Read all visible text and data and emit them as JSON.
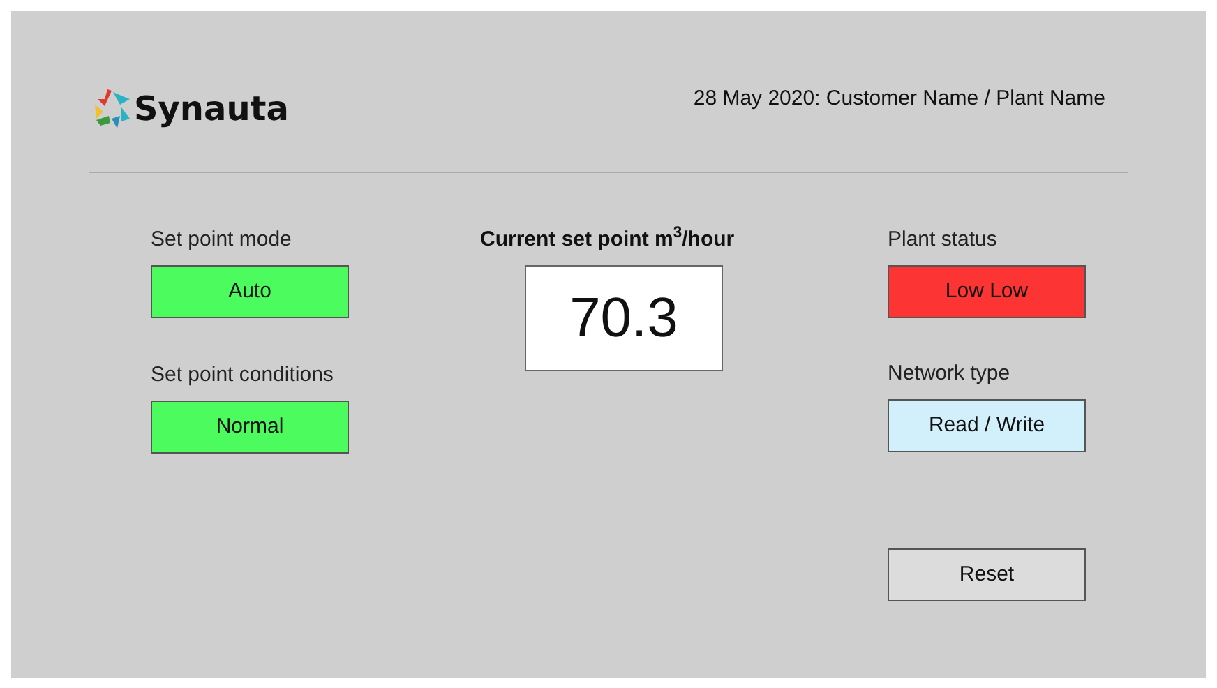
{
  "header": {
    "logo_text": "Synauta",
    "caption": "28 May 2020: Customer Name / Plant Name"
  },
  "left": [
    {
      "label": "Set point mode",
      "value": "Auto",
      "color": "#4cfb5e"
    },
    {
      "label": "Set point conditions",
      "value": "Normal",
      "color": "#4cfb5e"
    }
  ],
  "center": {
    "label": "Current set point m$^{3}$/hour",
    "value": "70.3"
  },
  "right": [
    {
      "kind": "status",
      "label": "Plant status",
      "value": "Low Low",
      "color": "#fc3434"
    },
    {
      "kind": "status",
      "label": "Network type",
      "value": "Read / Write",
      "color": "#d2effc"
    },
    {
      "kind": "button",
      "value": "Reset"
    }
  ]
}
